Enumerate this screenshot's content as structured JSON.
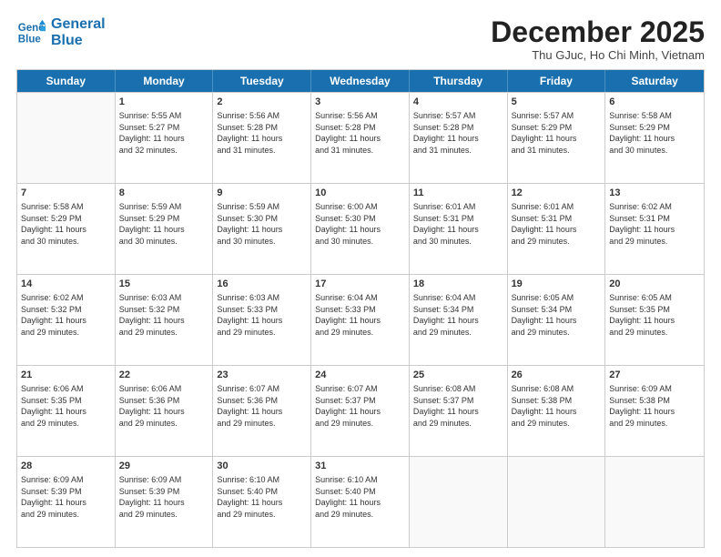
{
  "logo": {
    "line1": "General",
    "line2": "Blue"
  },
  "title": "December 2025",
  "subtitle": "Thu GJuc, Ho Chi Minh, Vietnam",
  "days_of_week": [
    "Sunday",
    "Monday",
    "Tuesday",
    "Wednesday",
    "Thursday",
    "Friday",
    "Saturday"
  ],
  "weeks": [
    [
      {
        "day": "",
        "text": ""
      },
      {
        "day": "1",
        "text": "Sunrise: 5:55 AM\nSunset: 5:27 PM\nDaylight: 11 hours\nand 32 minutes."
      },
      {
        "day": "2",
        "text": "Sunrise: 5:56 AM\nSunset: 5:28 PM\nDaylight: 11 hours\nand 31 minutes."
      },
      {
        "day": "3",
        "text": "Sunrise: 5:56 AM\nSunset: 5:28 PM\nDaylight: 11 hours\nand 31 minutes."
      },
      {
        "day": "4",
        "text": "Sunrise: 5:57 AM\nSunset: 5:28 PM\nDaylight: 11 hours\nand 31 minutes."
      },
      {
        "day": "5",
        "text": "Sunrise: 5:57 AM\nSunset: 5:29 PM\nDaylight: 11 hours\nand 31 minutes."
      },
      {
        "day": "6",
        "text": "Sunrise: 5:58 AM\nSunset: 5:29 PM\nDaylight: 11 hours\nand 30 minutes."
      }
    ],
    [
      {
        "day": "7",
        "text": "Sunrise: 5:58 AM\nSunset: 5:29 PM\nDaylight: 11 hours\nand 30 minutes."
      },
      {
        "day": "8",
        "text": "Sunrise: 5:59 AM\nSunset: 5:29 PM\nDaylight: 11 hours\nand 30 minutes."
      },
      {
        "day": "9",
        "text": "Sunrise: 5:59 AM\nSunset: 5:30 PM\nDaylight: 11 hours\nand 30 minutes."
      },
      {
        "day": "10",
        "text": "Sunrise: 6:00 AM\nSunset: 5:30 PM\nDaylight: 11 hours\nand 30 minutes."
      },
      {
        "day": "11",
        "text": "Sunrise: 6:01 AM\nSunset: 5:31 PM\nDaylight: 11 hours\nand 30 minutes."
      },
      {
        "day": "12",
        "text": "Sunrise: 6:01 AM\nSunset: 5:31 PM\nDaylight: 11 hours\nand 29 minutes."
      },
      {
        "day": "13",
        "text": "Sunrise: 6:02 AM\nSunset: 5:31 PM\nDaylight: 11 hours\nand 29 minutes."
      }
    ],
    [
      {
        "day": "14",
        "text": "Sunrise: 6:02 AM\nSunset: 5:32 PM\nDaylight: 11 hours\nand 29 minutes."
      },
      {
        "day": "15",
        "text": "Sunrise: 6:03 AM\nSunset: 5:32 PM\nDaylight: 11 hours\nand 29 minutes."
      },
      {
        "day": "16",
        "text": "Sunrise: 6:03 AM\nSunset: 5:33 PM\nDaylight: 11 hours\nand 29 minutes."
      },
      {
        "day": "17",
        "text": "Sunrise: 6:04 AM\nSunset: 5:33 PM\nDaylight: 11 hours\nand 29 minutes."
      },
      {
        "day": "18",
        "text": "Sunrise: 6:04 AM\nSunset: 5:34 PM\nDaylight: 11 hours\nand 29 minutes."
      },
      {
        "day": "19",
        "text": "Sunrise: 6:05 AM\nSunset: 5:34 PM\nDaylight: 11 hours\nand 29 minutes."
      },
      {
        "day": "20",
        "text": "Sunrise: 6:05 AM\nSunset: 5:35 PM\nDaylight: 11 hours\nand 29 minutes."
      }
    ],
    [
      {
        "day": "21",
        "text": "Sunrise: 6:06 AM\nSunset: 5:35 PM\nDaylight: 11 hours\nand 29 minutes."
      },
      {
        "day": "22",
        "text": "Sunrise: 6:06 AM\nSunset: 5:36 PM\nDaylight: 11 hours\nand 29 minutes."
      },
      {
        "day": "23",
        "text": "Sunrise: 6:07 AM\nSunset: 5:36 PM\nDaylight: 11 hours\nand 29 minutes."
      },
      {
        "day": "24",
        "text": "Sunrise: 6:07 AM\nSunset: 5:37 PM\nDaylight: 11 hours\nand 29 minutes."
      },
      {
        "day": "25",
        "text": "Sunrise: 6:08 AM\nSunset: 5:37 PM\nDaylight: 11 hours\nand 29 minutes."
      },
      {
        "day": "26",
        "text": "Sunrise: 6:08 AM\nSunset: 5:38 PM\nDaylight: 11 hours\nand 29 minutes."
      },
      {
        "day": "27",
        "text": "Sunrise: 6:09 AM\nSunset: 5:38 PM\nDaylight: 11 hours\nand 29 minutes."
      }
    ],
    [
      {
        "day": "28",
        "text": "Sunrise: 6:09 AM\nSunset: 5:39 PM\nDaylight: 11 hours\nand 29 minutes."
      },
      {
        "day": "29",
        "text": "Sunrise: 6:09 AM\nSunset: 5:39 PM\nDaylight: 11 hours\nand 29 minutes."
      },
      {
        "day": "30",
        "text": "Sunrise: 6:10 AM\nSunset: 5:40 PM\nDaylight: 11 hours\nand 29 minutes."
      },
      {
        "day": "31",
        "text": "Sunrise: 6:10 AM\nSunset: 5:40 PM\nDaylight: 11 hours\nand 29 minutes."
      },
      {
        "day": "",
        "text": ""
      },
      {
        "day": "",
        "text": ""
      },
      {
        "day": "",
        "text": ""
      }
    ]
  ]
}
